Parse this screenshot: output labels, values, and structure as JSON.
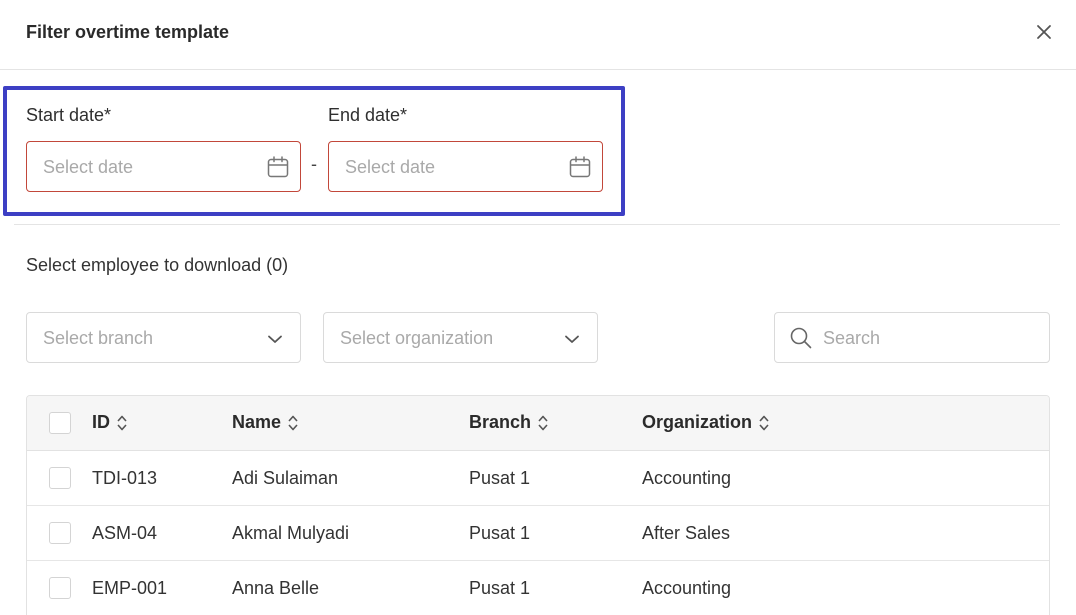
{
  "dialog": {
    "title": "Filter overtime template",
    "close_icon": "close-icon"
  },
  "dates": {
    "start_label": "Start date*",
    "start_placeholder": "Select date",
    "separator": "-",
    "end_label": "End date*",
    "end_placeholder": "Select date",
    "calendar_icon": "calendar-icon"
  },
  "employees": {
    "section_label": "Select employee to download (0)",
    "branch_placeholder": "Select branch",
    "organization_placeholder": "Select organization",
    "search_placeholder": "Search",
    "search_value": ""
  },
  "table": {
    "columns": [
      "ID",
      "Name",
      "Branch",
      "Organization"
    ],
    "rows": [
      [
        "TDI-013",
        "Adi Sulaiman",
        "Pusat 1",
        "Accounting"
      ],
      [
        "ASM-04",
        "Akmal Mulyadi",
        "Pusat 1",
        "After Sales"
      ],
      [
        "EMP-001",
        "Anna Belle",
        "Pusat 1",
        "Accounting"
      ]
    ]
  },
  "colors": {
    "highlight": "#3d3fc4",
    "error_border": "#c2473a",
    "placeholder": "#a9a9a9"
  }
}
